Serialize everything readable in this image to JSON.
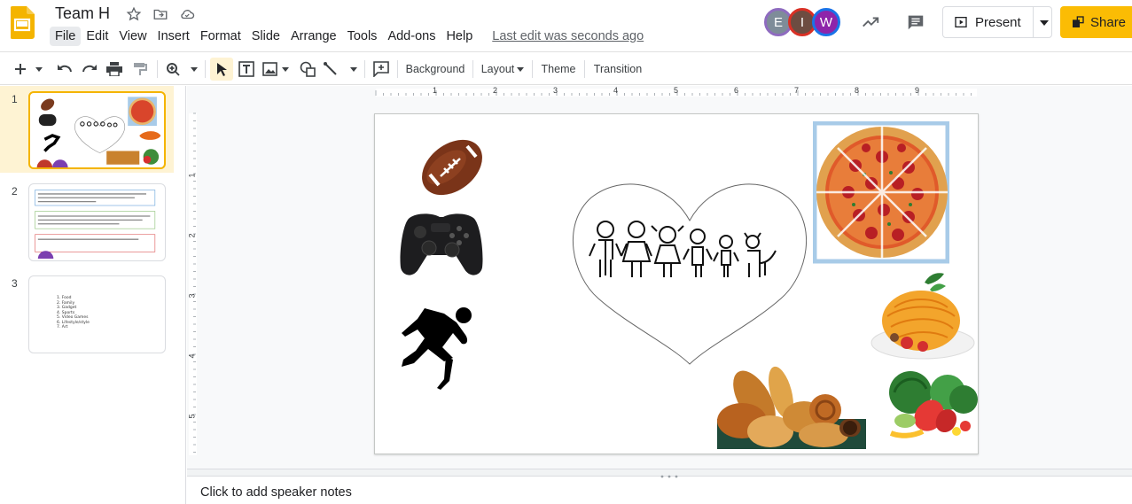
{
  "app": {
    "doc_title": "Team H",
    "menu": [
      "File",
      "Edit",
      "View",
      "Insert",
      "Format",
      "Slide",
      "Arrange",
      "Tools",
      "Add-ons",
      "Help"
    ],
    "last_edit": "Last edit was seconds ago"
  },
  "header": {
    "avatars": [
      {
        "initial": "E",
        "bg": "#7e8c99",
        "ring": "#8e6bbf"
      },
      {
        "initial": "I",
        "bg": "#6d4c41",
        "ring": "#d93025"
      },
      {
        "initial": "W",
        "bg": "#8e24aa",
        "ring": "#1a73e8"
      }
    ],
    "present_label": "Present",
    "share_label": "Share"
  },
  "toolbar": {
    "background_label": "Background",
    "layout_label": "Layout",
    "theme_label": "Theme",
    "transition_label": "Transition"
  },
  "ruler": {
    "h_labels": [
      "1",
      "2",
      "3",
      "4",
      "5",
      "6",
      "7",
      "8",
      "9"
    ],
    "v_labels": [
      "1",
      "2",
      "3",
      "4",
      "5"
    ]
  },
  "filmstrip": {
    "slides": [
      {
        "number": "1"
      },
      {
        "number": "2"
      },
      {
        "number": "3",
        "list": [
          "Food",
          "Family",
          "Gadget",
          "Sports",
          "Video Games",
          "Lifestyle/style",
          "Art"
        ]
      }
    ]
  },
  "notes": {
    "placeholder": "Click to add speaker notes"
  },
  "colors": {
    "accent_yellow": "#fbbc04",
    "selected_bg": "#fef3d3",
    "active_border": "#f4b400"
  },
  "slide_icons": [
    "football-icon",
    "game-controller-icon",
    "runner-icon",
    "heart-family-icon",
    "pizza-icon",
    "spaghetti-icon",
    "bread-icon",
    "vegetables-icon"
  ]
}
